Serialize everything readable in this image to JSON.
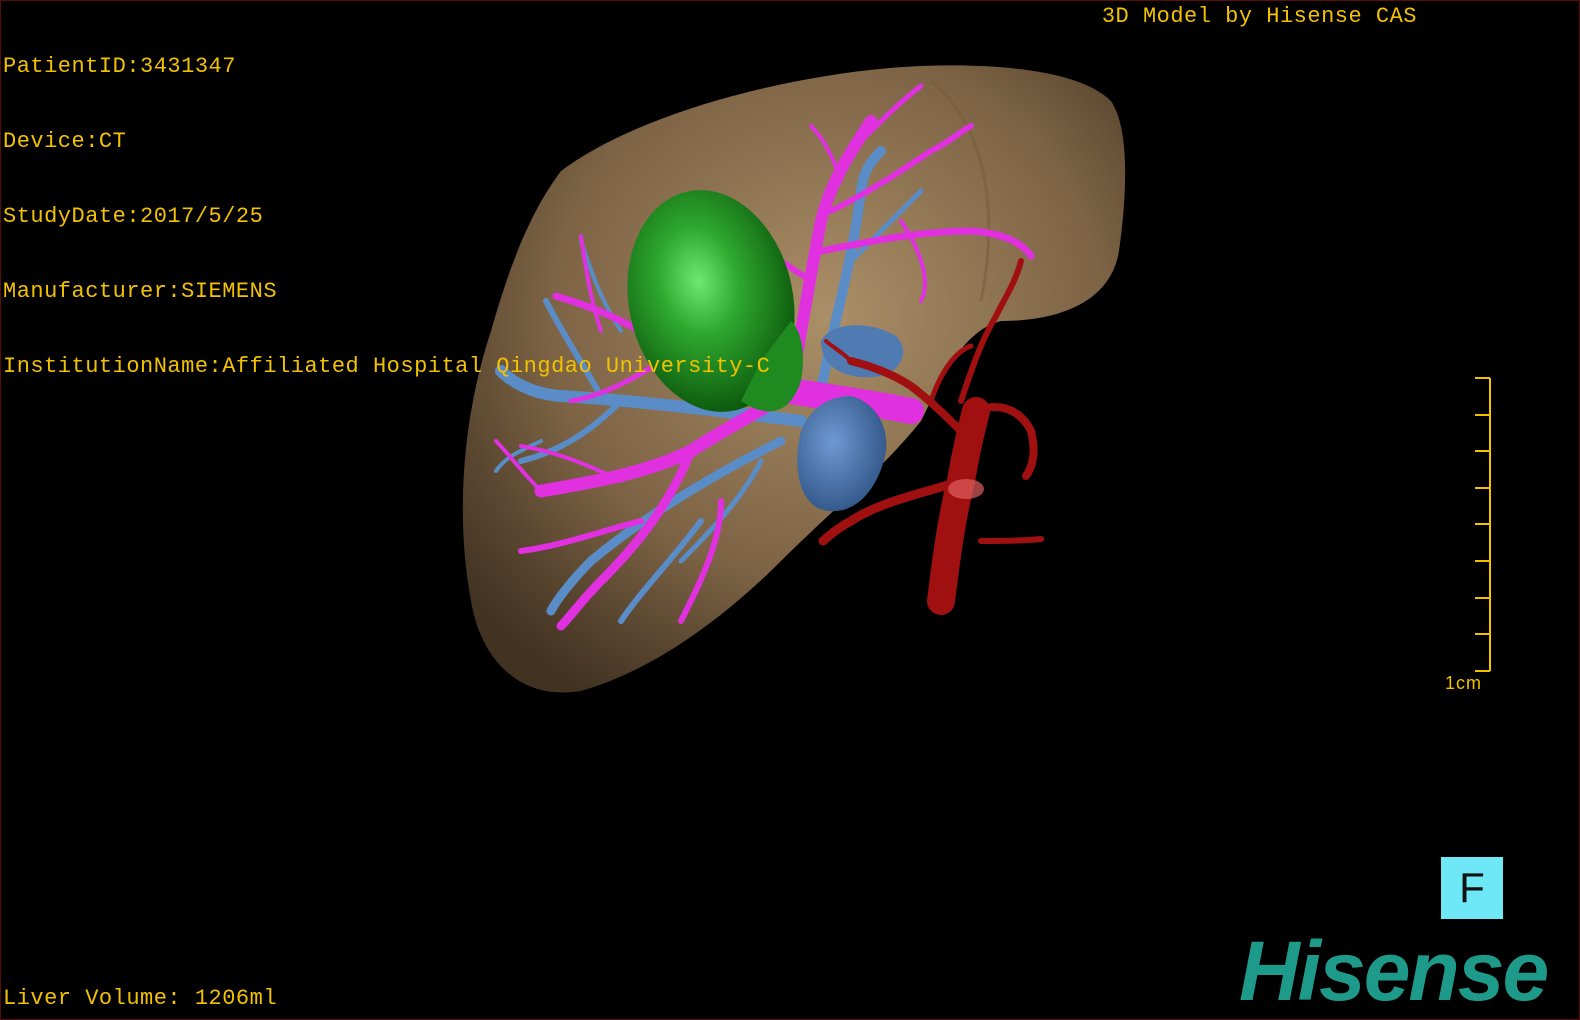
{
  "header": {
    "patient_id": "PatientID:3431347",
    "device": "Device:CT",
    "study_date": "StudyDate:2017/5/25",
    "manufacturer": "Manufacturer:SIEMENS",
    "institution": "InstitutionName:Affiliated Hospital Qingdao University-C",
    "credit": "3D Model by Hisense CAS"
  },
  "footer": {
    "liver_volume": "Liver Volume: 1206ml"
  },
  "scale": {
    "label": "1cm"
  },
  "orientation": {
    "label": "F"
  },
  "brand": {
    "name": "Hisense"
  },
  "colors": {
    "overlay_text": "#f2c200",
    "liver": "#b0906a",
    "tumor": "#1f8a1f",
    "portal_vein": "#e030e0",
    "hepatic_vein": "#5a8cc8",
    "artery": "#a01010",
    "orientation_button": "#6ee8f6",
    "brand": "#1e9a8a"
  }
}
